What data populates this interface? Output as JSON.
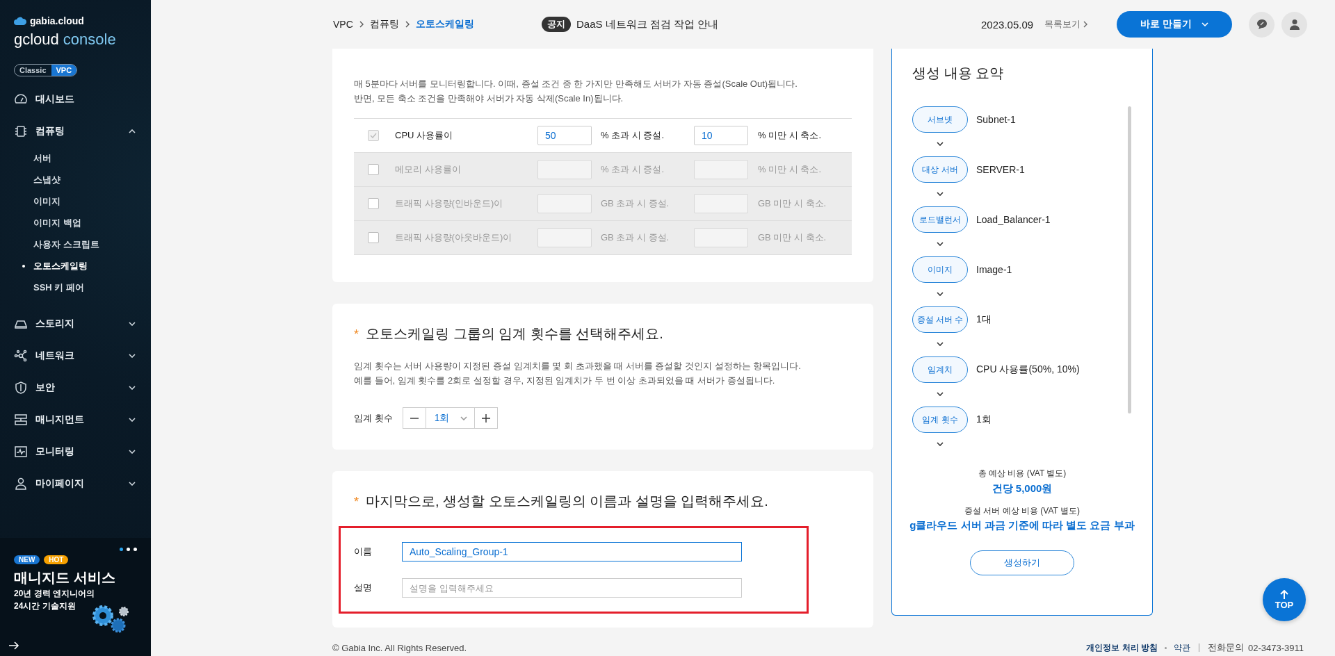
{
  "sidebar": {
    "brand": "gabia.cloud",
    "title_main": "gcloud",
    "title_sub": "console",
    "modes": [
      {
        "label": "Classic",
        "selected": false
      },
      {
        "label": "VPC",
        "selected": true
      }
    ],
    "nav": [
      {
        "label": "대시보드"
      },
      {
        "label": "컴퓨팅",
        "expanded": true,
        "children": [
          {
            "label": "서버",
            "selected": false
          },
          {
            "label": "스냅샷",
            "selected": false
          },
          {
            "label": "이미지",
            "selected": false
          },
          {
            "label": "이미지 백업",
            "selected": false
          },
          {
            "label": "사용자 스크립트",
            "selected": false
          },
          {
            "label": "오토스케일링",
            "selected": true
          },
          {
            "label": "SSH 키 페어",
            "selected": false
          }
        ]
      },
      {
        "label": "스토리지",
        "expanded": false
      },
      {
        "label": "네트워크",
        "expanded": false
      },
      {
        "label": "보안",
        "expanded": false
      },
      {
        "label": "매니지먼트",
        "expanded": false
      },
      {
        "label": "모니터링",
        "expanded": false
      },
      {
        "label": "마이페이지",
        "expanded": false
      }
    ],
    "banner": {
      "dots": [
        {
          "selected": true
        },
        {
          "selected": false
        },
        {
          "selected": false
        }
      ],
      "badges": [
        {
          "label": "NEW",
          "color": "#1976d2"
        },
        {
          "label": "HOT",
          "color": "#f5a000"
        }
      ],
      "title": "매니지드 서비스",
      "lines": [
        "20년 경력 엔지니어의",
        "24시간 기술지원"
      ]
    }
  },
  "header": {
    "breadcrumb": [
      {
        "label": "VPC",
        "current": false
      },
      {
        "label": "컴퓨팅",
        "current": false
      },
      {
        "label": "오토스케일링",
        "current": true
      }
    ],
    "notice": {
      "badge": "공지",
      "text": "DaaS 네트워크 점검 작업 안내",
      "date": "2023.05.09",
      "list_link": "목록보기"
    },
    "create_button": "바로 만들기"
  },
  "monitoring": {
    "description": [
      "매 5분마다 서버를 모니터링합니다. 이때, 증설 조건 중 한 가지만 만족해도 서버가 자동 증설(Scale Out)됩니다.",
      "반면, 모든 축소 조건을 만족해야 서버가 자동 삭제(Scale In)됩니다."
    ],
    "conditions": [
      {
        "label": "CPU 사용률이",
        "checked": true,
        "grow_value": "50",
        "grow_unit": "% 초과 시 증설.",
        "shrink_value": "10",
        "shrink_unit": "% 미만 시 축소."
      },
      {
        "label": "메모리 사용률이",
        "checked": false,
        "grow_unit": "% 초과 시 증설.",
        "shrink_unit": "% 미만 시 축소."
      },
      {
        "label": "트래픽 사용량(인바운드)이",
        "checked": false,
        "grow_unit": "GB 초과 시 증설.",
        "shrink_unit": "GB 미만 시 축소."
      },
      {
        "label": "트래픽 사용량(아웃바운드)이",
        "checked": false,
        "grow_unit": "GB 초과 시 증설.",
        "shrink_unit": "GB 미만 시 축소."
      }
    ]
  },
  "threshold": {
    "marker": "*",
    "title": "오토스케일링 그룹의 임계 횟수를 선택해주세요.",
    "description": [
      "임계 횟수는 서버 사용량이 지정된 증설 임계치를 몇 회 초과했을 때 서버를 증설할 것인지 설정하는 항목입니다.",
      "예를 들어, 임계 횟수를 2회로 설정할 경우, 지정된 임계치가 두 번 이상 초과되었을 때 서버가 증설됩니다."
    ],
    "label": "임계 횟수",
    "value": "1회"
  },
  "naming": {
    "marker": "*",
    "title": "마지막으로, 생성할 오토스케일링의 이름과 설명을 입력해주세요.",
    "highlighted": true,
    "fields": [
      {
        "label": "이름",
        "value": "Auto_Scaling_Group-1"
      },
      {
        "label": "설명",
        "placeholder": "설명을 입력해주세요"
      }
    ]
  },
  "summary": {
    "title": "생성 내용 요약",
    "steps": [
      {
        "label": "서브넷",
        "value": "Subnet-1"
      },
      {
        "label": "대상 서버",
        "value": "SERVER-1"
      },
      {
        "label": "로드밸런서",
        "value": "Load_Balancer-1"
      },
      {
        "label": "이미지",
        "value": "Image-1"
      },
      {
        "label": "증설 서버 수",
        "value": "1대"
      },
      {
        "label": "임계치",
        "value": "CPU 사용률(50%, 10%)"
      },
      {
        "label": "임계 횟수",
        "value": "1회"
      }
    ],
    "cost_label": "총 예상 비용 (VAT 별도)",
    "cost_value": "건당 5,000원",
    "extra_label": "증설 서버 예상 비용 (VAT 별도)",
    "extra_value": "g클라우드 서버 과금 기준에 따라 별도 요금 부과",
    "create_button": "생성하기"
  },
  "footer": {
    "copyright": "© Gabia Inc. All Rights Reserved.",
    "links": [
      {
        "label": "개인정보 처리 방침",
        "bold": true
      },
      {
        "label": "약관",
        "bold": false
      }
    ],
    "phone_label": "전화문의",
    "phone": "02-3473-3911"
  },
  "top_button": "TOP"
}
